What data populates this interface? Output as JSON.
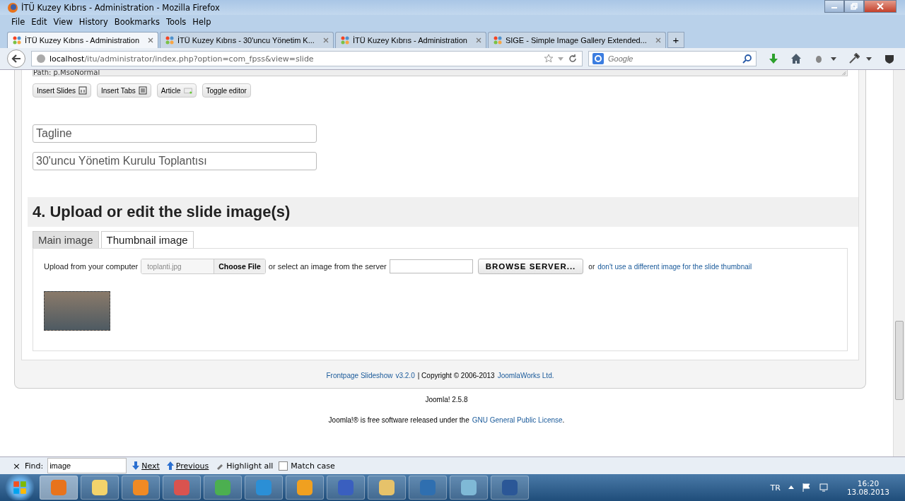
{
  "window": {
    "title": "İTÜ Kuzey Kıbrıs - Administration - Mozilla Firefox"
  },
  "menu": [
    "File",
    "Edit",
    "View",
    "History",
    "Bookmarks",
    "Tools",
    "Help"
  ],
  "browser_tabs": [
    {
      "label": "İTÜ Kuzey Kıbrıs - Administration",
      "selected": true
    },
    {
      "label": "İTÜ Kuzey Kıbrıs - 30'uncu Yönetim K...",
      "selected": false
    },
    {
      "label": "İTÜ Kuzey Kıbrıs - Administration",
      "selected": false
    },
    {
      "label": "SIGE - Simple Image Gallery Extended...",
      "selected": false
    }
  ],
  "new_tab": "+",
  "address": {
    "host": "localhost",
    "path": "/itu/administrator/index.php?option=com_fpss&view=slide"
  },
  "search": {
    "placeholder": "Google"
  },
  "editor": {
    "path": "Path: p.MsoNormal",
    "buttons": [
      {
        "label": "Insert Slides",
        "kind": "slides"
      },
      {
        "label": "Insert Tabs",
        "kind": "tabs"
      },
      {
        "label": "Article",
        "kind": "article"
      },
      {
        "label": "Toggle editor",
        "kind": "none"
      }
    ]
  },
  "fields": [
    {
      "value": "Tagline"
    },
    {
      "value": "30'uncu Yönetim Kurulu Toplantısı"
    }
  ],
  "section_title": "4. Upload or edit the slide image(s)",
  "image_tabs": [
    {
      "label": "Main image",
      "selected": false
    },
    {
      "label": "Thumbnail image",
      "selected": true
    }
  ],
  "upload": {
    "label": "Upload from your computer",
    "file_name": "toplanti.jpg",
    "choose": "Choose File",
    "or_select": "or select an image from the server",
    "browse": "BROWSE SERVER...",
    "or": "or",
    "link": "don't use a different image for the slide thumbnail"
  },
  "footer": {
    "product": "Frontpage Slideshow",
    "version": "v3.2.0",
    "copyright": "| Copyright © 2006-2013",
    "company": "JoomlaWorks Ltd."
  },
  "joomla_version": "Joomla! 2.5.8",
  "license": {
    "before": "Joomla!® is free software released under the",
    "link": "GNU General Public License",
    "after": "."
  },
  "find_bar": {
    "close": "×",
    "label": "Find:",
    "value": "image",
    "next": "Next",
    "previous": "Previous",
    "highlight": "Highlight all",
    "match_case": {
      "label": "Match case",
      "checked": false
    }
  },
  "taskbar": {
    "language": "TR",
    "time": "16:20",
    "date": "13.08.2013",
    "apps": [
      {
        "kind": "firefox",
        "selected": true
      },
      {
        "kind": "folder",
        "selected": false
      },
      {
        "kind": "media",
        "selected": false
      },
      {
        "kind": "snip",
        "selected": false
      },
      {
        "kind": "chrome",
        "selected": false
      },
      {
        "kind": "ie",
        "selected": false
      },
      {
        "kind": "outlook",
        "selected": false
      },
      {
        "kind": "visio",
        "selected": false
      },
      {
        "kind": "paint",
        "selected": false
      },
      {
        "kind": "publisher",
        "selected": false
      },
      {
        "kind": "book",
        "selected": false
      },
      {
        "kind": "word",
        "selected": false
      }
    ]
  }
}
